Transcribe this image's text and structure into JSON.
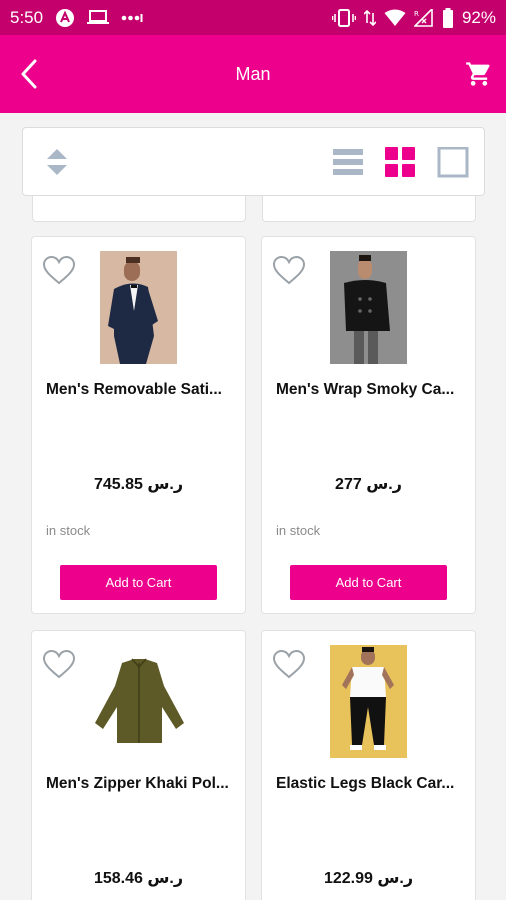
{
  "status_bar": {
    "time": "5:50",
    "battery_percent": "92%",
    "icons": [
      "app-icon",
      "laptop-icon",
      "dots-icon",
      "vibrate-icon",
      "data-arrows-icon",
      "wifi-icon",
      "signal-icon",
      "battery-icon"
    ]
  },
  "app_bar": {
    "title": "Man",
    "back_icon": "back-arrow-icon",
    "cart_icon": "cart-icon"
  },
  "toolbar": {
    "sort_icon": "sort-arrows-icon",
    "view_options": [
      "list-view-icon",
      "grid-view-icon",
      "single-view-icon"
    ],
    "selected_view": "grid-view-icon"
  },
  "colors": {
    "status_bar": "#c4006c",
    "accent": "#ec008c",
    "muted_icon": "#a9b7c6"
  },
  "products": [
    {
      "name": "Men's Removable Sati...",
      "price": "ر.س 745.85",
      "stock": "in stock",
      "button": "Add to Cart"
    },
    {
      "name": "Men's Wrap Smoky Ca...",
      "price": "ر.س 277",
      "stock": "in stock",
      "button": "Add to Cart"
    },
    {
      "name": "Men's Zipper Khaki Pol...",
      "price": "ر.س 158.46"
    },
    {
      "name": "Elastic Legs Black Car...",
      "price": "ر.س 122.99"
    }
  ]
}
